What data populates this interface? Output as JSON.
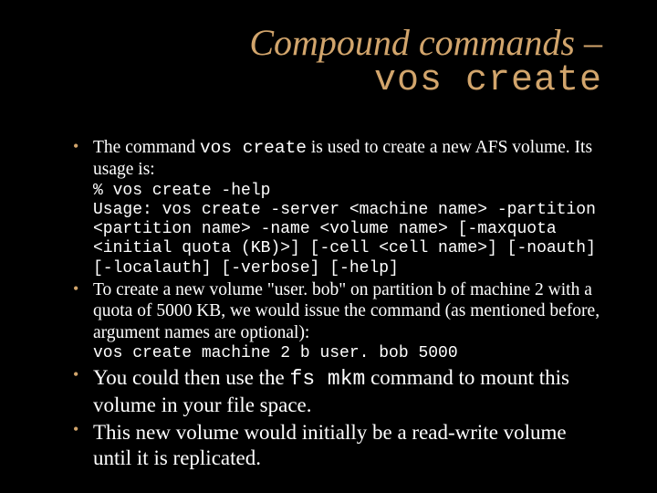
{
  "title": {
    "line1": "Compound commands –",
    "line2": "vos create"
  },
  "bullets": {
    "b1": {
      "pre": "The command ",
      "cmd": "vos create",
      "post": " is used to create a new AFS volume.  Its usage is:",
      "code": "% vos create -help\nUsage: vos create -server <machine name> -partition\n<partition name> -name <volume name> [-maxquota\n<initial quota (KB)>] [-cell <cell name>] [-noauth]\n[-localauth] [-verbose] [-help]"
    },
    "b2": {
      "text": "To create a new volume \"user. bob\" on partition b of machine 2 with a quota of 5000 KB, we would issue the command (as mentioned before, argument names are optional):",
      "code": "vos create machine 2 b user. bob 5000"
    },
    "b3": {
      "pre": "You could then use the ",
      "cmd": "fs mkm",
      "post": " command to mount this volume in your file space."
    },
    "b4": {
      "text": "This new volume would initially be a read-write volume until it is replicated."
    }
  }
}
